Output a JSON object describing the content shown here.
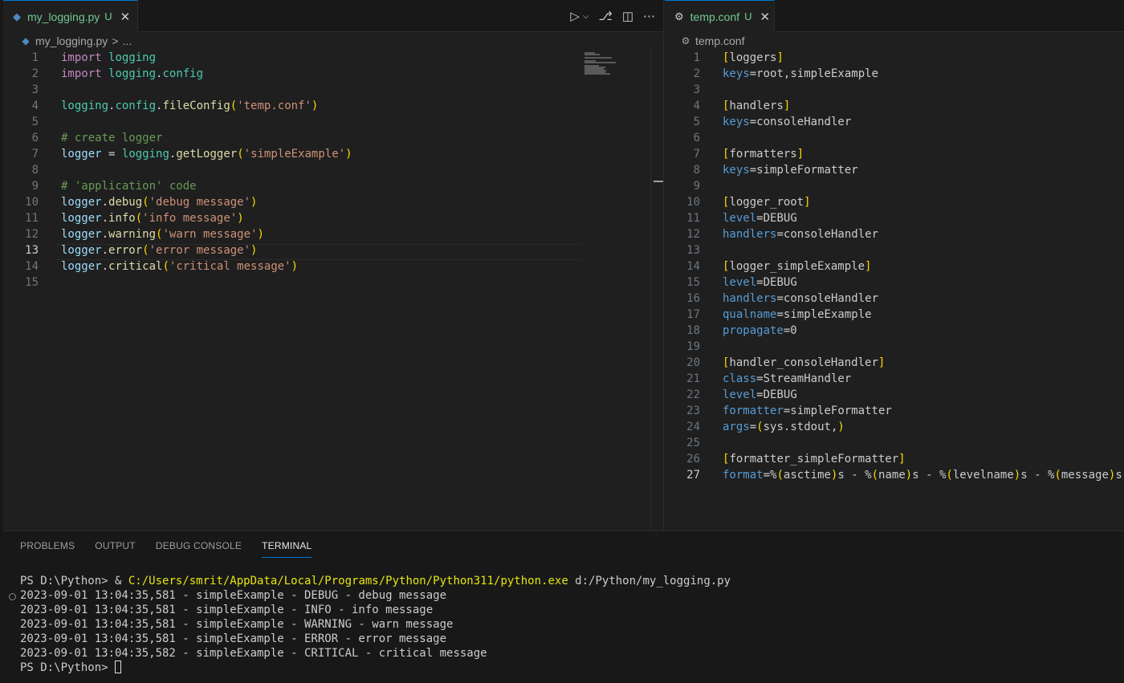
{
  "left_editor": {
    "tab": {
      "icon": "python-file-icon",
      "label": "my_logging.py",
      "status": "U"
    },
    "breadcrumb": {
      "file": "my_logging.py",
      "sep": ">",
      "more": "..."
    },
    "active_line": 13,
    "lines": [
      "import logging",
      "import logging.config",
      "",
      "logging.config.fileConfig('temp.conf')",
      "",
      "# create logger",
      "logger = logging.getLogger('simpleExample')",
      "",
      "# 'application' code",
      "logger.debug('debug message')",
      "logger.info('info message')",
      "logger.warning('warn message')",
      "logger.error('error message')",
      "logger.critical('critical message')",
      ""
    ]
  },
  "right_editor": {
    "tab": {
      "icon": "gear-icon",
      "label": "temp.conf",
      "status": "U"
    },
    "breadcrumb": {
      "file": "temp.conf"
    },
    "active_line": 27,
    "lines": [
      "[loggers]",
      "keys=root,simpleExample",
      "",
      "[handlers]",
      "keys=consoleHandler",
      "",
      "[formatters]",
      "keys=simpleFormatter",
      "",
      "[logger_root]",
      "level=DEBUG",
      "handlers=consoleHandler",
      "",
      "[logger_simpleExample]",
      "level=DEBUG",
      "handlers=consoleHandler",
      "qualname=simpleExample",
      "propagate=0",
      "",
      "[handler_consoleHandler]",
      "class=StreamHandler",
      "level=DEBUG",
      "formatter=simpleFormatter",
      "args=(sys.stdout,)",
      "",
      "[formatter_simpleFormatter]",
      "format=%(asctime)s - %(name)s - %(levelname)s - %(message)s"
    ]
  },
  "editor_actions": [
    "run-icon",
    "chevron-down-icon",
    "source-control-icon",
    "split-editor-icon",
    "more-icon"
  ],
  "panel": {
    "tabs": [
      "PROBLEMS",
      "OUTPUT",
      "DEBUG CONSOLE",
      "TERMINAL"
    ],
    "active_tab": "TERMINAL",
    "terminal": {
      "prompt": "PS D:\\Python> ",
      "command_prefix": "& ",
      "command_exe": "C:/Users/smrit/AppData/Local/Programs/Python/Python311/python.exe",
      "command_arg": " d:/Python/my_logging.py",
      "output": [
        "2023-09-01 13:04:35,581 - simpleExample - DEBUG - debug message",
        "2023-09-01 13:04:35,581 - simpleExample - INFO - info message",
        "2023-09-01 13:04:35,581 - simpleExample - WARNING - warn message",
        "2023-09-01 13:04:35,581 - simpleExample - ERROR - error message",
        "2023-09-01 13:04:35,582 - simpleExample - CRITICAL - critical message"
      ],
      "final_prompt": "PS D:\\Python> "
    }
  }
}
